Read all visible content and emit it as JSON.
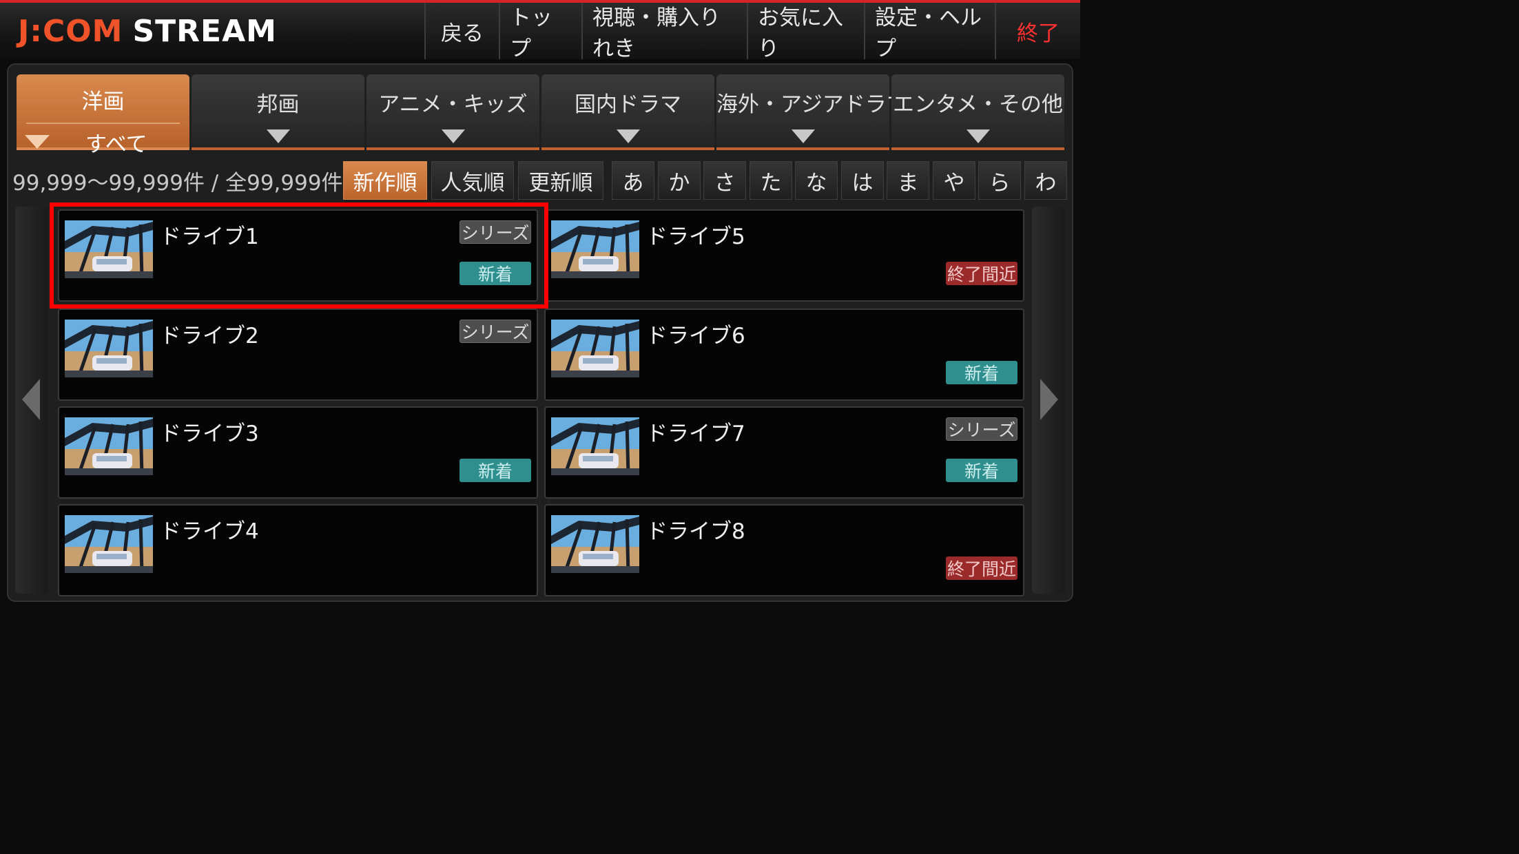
{
  "header": {
    "logo_main": "J:COM",
    "logo_sub": "STREAM",
    "nav": [
      {
        "label": "戻る"
      },
      {
        "label": "トップ"
      },
      {
        "label": "視聴・購入りれき"
      },
      {
        "label": "お気に入り"
      },
      {
        "label": "設定・ヘルプ"
      },
      {
        "label": "終了"
      }
    ]
  },
  "tabs": [
    {
      "label": "洋画",
      "sub": "すべて",
      "active": true
    },
    {
      "label": "邦画"
    },
    {
      "label": "アニメ・キッズ"
    },
    {
      "label": "国内ドラマ"
    },
    {
      "label": "海外・アジアドラマ"
    },
    {
      "label": "エンタメ・その他"
    }
  ],
  "filter": {
    "count": "99,999～99,999件 / 全99,999件",
    "sort": [
      "新作順",
      "人気順",
      "更新順"
    ],
    "sort_active": "新作順",
    "kana": [
      "あ",
      "か",
      "さ",
      "た",
      "な",
      "は",
      "ま",
      "や",
      "ら",
      "わ"
    ]
  },
  "items": [
    {
      "title": "ドライブ1",
      "series": "シリーズ",
      "status": "新着"
    },
    {
      "title": "ドライブ2",
      "series": "シリーズ",
      "status": ""
    },
    {
      "title": "ドライブ3",
      "series": "",
      "status": "新着"
    },
    {
      "title": "ドライブ4",
      "series": "",
      "status": ""
    },
    {
      "title": "ドライブ5",
      "series": "",
      "status": "終了間近"
    },
    {
      "title": "ドライブ6",
      "series": "",
      "status": "新着"
    },
    {
      "title": "ドライブ7",
      "series": "シリーズ",
      "status": "新着"
    },
    {
      "title": "ドライブ8",
      "series": "",
      "status": "終了間近"
    }
  ],
  "colors": {
    "accent": "#c96f35",
    "new": "#2f8f8f",
    "ending": "#9b2a2a",
    "exit": "#ff3030",
    "highlight": "#ff0000"
  }
}
